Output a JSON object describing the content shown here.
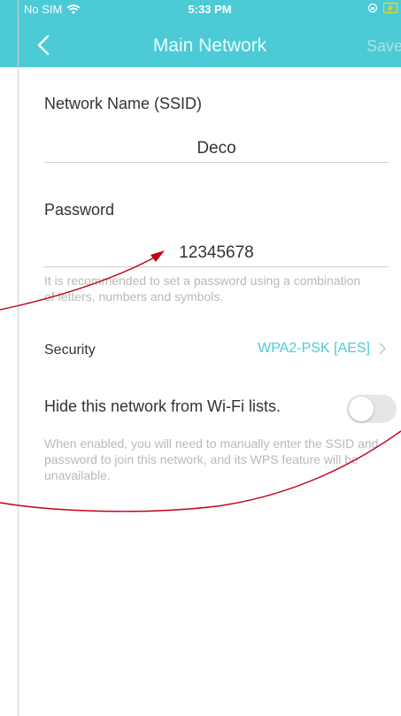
{
  "status_bar": {
    "carrier": "No SIM",
    "time": "5:33 PM"
  },
  "header": {
    "title": "Main Network",
    "save_label": "Save"
  },
  "ssid": {
    "label": "Network Name (SSID)",
    "value": "Deco"
  },
  "password": {
    "label": "Password",
    "value": "12345678",
    "hint": "It is recommended to set a password using a combination of letters, numbers and symbols."
  },
  "security": {
    "label": "Security",
    "value": "WPA2-PSK [AES]"
  },
  "hide_network": {
    "label": "Hide this network from Wi-Fi lists.",
    "enabled": false,
    "note": "When enabled, you will need to manually enter the SSID and password to join this network, and its WPS feature will be unavailable."
  },
  "colors": {
    "accent": "#4ccad6",
    "annotation": "#c0001a"
  },
  "icons": [
    "wifi-icon",
    "orientation-lock-icon",
    "battery-charging-icon",
    "back-chevron-icon",
    "chevron-right-icon"
  ]
}
